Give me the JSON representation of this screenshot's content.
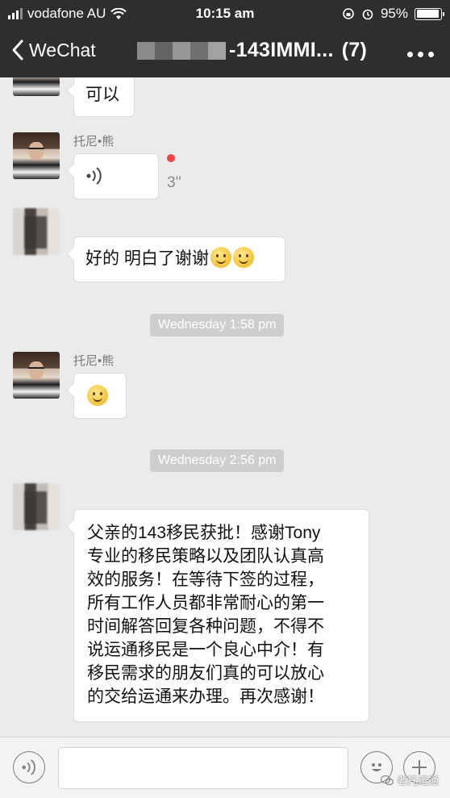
{
  "status_bar": {
    "carrier": "vodafone AU",
    "time": "10:15 am",
    "battery": "95%",
    "battery_level": 0.95
  },
  "nav": {
    "back_label": "WeChat",
    "title": "-143IMMI...",
    "member_count": "(7)"
  },
  "messages": [
    {
      "sender": "",
      "text": "可以"
    },
    {
      "sender": "托尼•熊",
      "type": "voice",
      "duration": "3''"
    },
    {
      "sender": "",
      "text": "好的 明白了谢谢"
    },
    {
      "timestamp": "Wednesday 1:58 pm"
    },
    {
      "sender": "托尼•熊",
      "type": "emoji"
    },
    {
      "timestamp": "Wednesday 2:56 pm"
    },
    {
      "sender": "",
      "lines": [
        "父亲的143移民获批！感谢Tony",
        "专业的移民策略以及团队认真高",
        "效的服务！在等待下签的过程，",
        "所有工作人员都非常耐心的第一",
        "时间解答回复各种问题，不得不",
        "说运通移民是一个良心中介！有",
        "移民需求的朋友们真的可以放心",
        "的交给运通来办理。再次感谢！"
      ]
    }
  ],
  "watermark": "老托运通",
  "icons": {
    "voice": "voice-icon",
    "emoji": "emoji-icon",
    "plus": "plus-icon",
    "back": "chevron-left-icon",
    "more": "more-icon"
  }
}
